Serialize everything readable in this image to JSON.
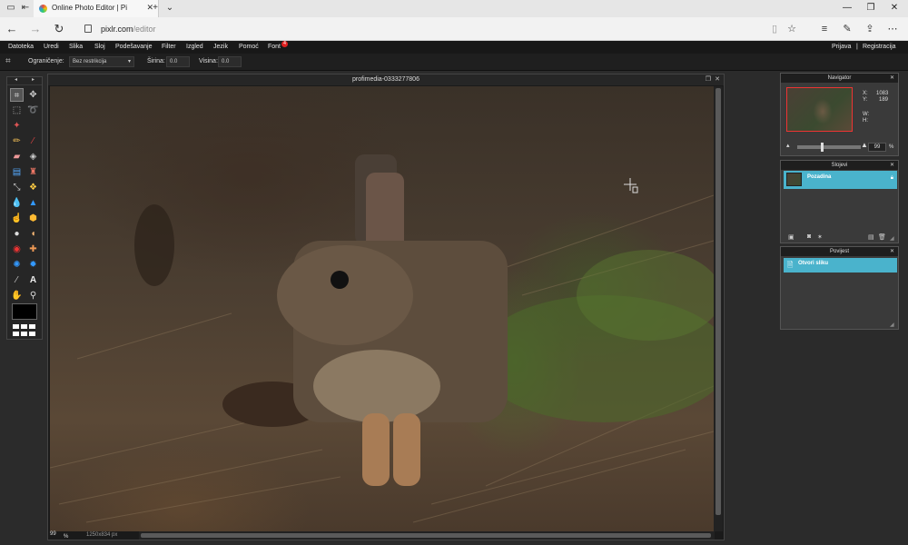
{
  "browser": {
    "tab_title": "Online Photo Editor | Pi",
    "url_host": "pixlr.com",
    "url_path": "/editor"
  },
  "menu": {
    "items": [
      "Datoteka",
      "Uredi",
      "Slika",
      "Sloj",
      "Podešavanje",
      "Filter",
      "Izgled",
      "Jezik",
      "Pomoć",
      "Font"
    ],
    "font_badge": "4",
    "login": "Prijava",
    "separator": "|",
    "register": "Registracija"
  },
  "options": {
    "constraint_label": "Ograničenje:",
    "constraint_value": "Bez restrikcija",
    "width_label": "Širina:",
    "width_value": "0.0",
    "height_label": "Visina:",
    "height_value": "0.0"
  },
  "document": {
    "title": "profimedia-0333277806",
    "zoom": "99",
    "zoom_unit": "%",
    "size": "1250x834 px"
  },
  "navigator": {
    "title": "Navigator",
    "x_label": "X:",
    "x_value": "1083",
    "y_label": "Y:",
    "y_value": "189",
    "w_label": "W:",
    "h_label": "H:",
    "zoom_value": "99",
    "zoom_unit": "%"
  },
  "layers": {
    "title": "Slojevi",
    "items": [
      {
        "name": "Pozadina"
      }
    ]
  },
  "history": {
    "title": "Povijest",
    "items": [
      {
        "name": "Otvori sliku"
      }
    ]
  },
  "icons": {
    "tab_icons": [
      "tab-manager-icon",
      "back-to-tabs-icon"
    ],
    "nav": [
      "back-icon",
      "forward-icon",
      "refresh-icon"
    ],
    "address": [
      "reading-view-icon",
      "favorite-star-icon",
      "hub-icon",
      "notes-icon",
      "share-icon",
      "more-icon"
    ]
  }
}
